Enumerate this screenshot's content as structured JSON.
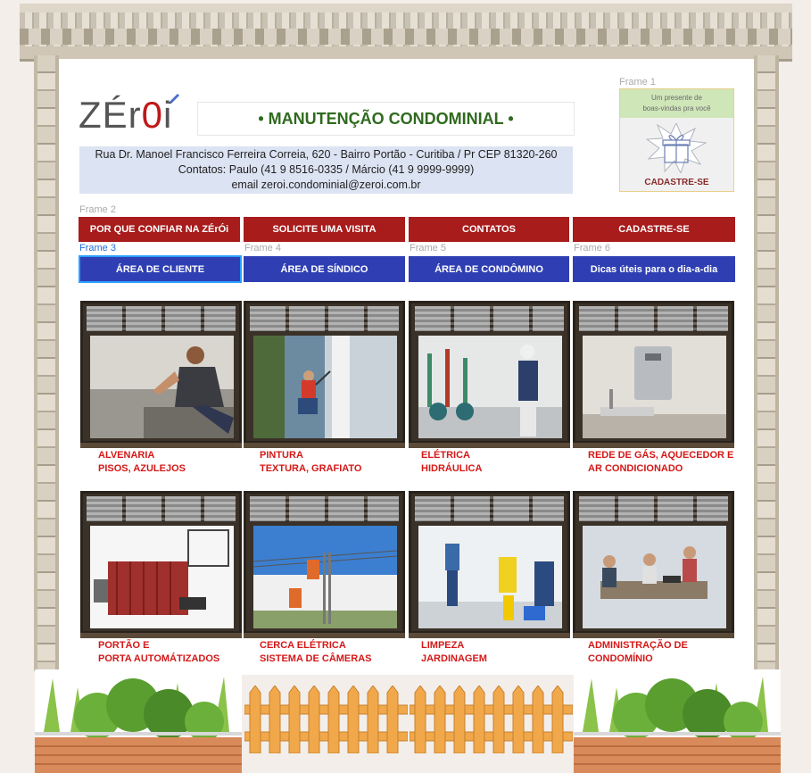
{
  "header": {
    "logo_text_a": "ZÉr",
    "logo_text_o": "0",
    "logo_text_b": "i",
    "title": "• MANUTENÇÃO CONDOMINIAL •",
    "address": "Rua Dr. Manoel Francisco Ferreira Correia, 620 - Bairro Portão - Curitiba / Pr CEP 81320-260",
    "contacts": "Contatos: Paulo (41 9 8516-0335 / Márcio (41 9 9999-9999)",
    "email": "email zeroi.condominial@zeroi.com.br"
  },
  "gift_panel": {
    "frame_label": "Frame 1",
    "line1": "Um presente de",
    "line2": "boas-vindas pra você",
    "cta": "CADASTRE-SE"
  },
  "frames": {
    "f2": "Frame 2",
    "f3": "Frame 3",
    "f4": "Frame 4",
    "f5": "Frame 5",
    "f6": "Frame 6"
  },
  "nav_red": [
    "POR QUE CONFIAR NA ZÉrÓi",
    "SOLICITE UMA VISITA",
    "CONTATOS",
    "CADASTRE-SE"
  ],
  "nav_blue": [
    "ÁREA DE CLIENTE",
    "ÁREA DE SÍNDICO",
    "ÁREA DE CONDÔMINO",
    "Dicas úteis para o dia-a-dia"
  ],
  "services": [
    {
      "l1": "ALVENARIA",
      "l2": "PISOS, AZULEJOS"
    },
    {
      "l1": "PINTURA",
      "l2": "TEXTURA, GRAFIATO"
    },
    {
      "l1": "ELÉTRICA",
      "l2": "HIDRÁULICA"
    },
    {
      "l1": "REDE DE GÁS, AQUECEDOR E",
      "l2": "AR CONDICIONADO"
    },
    {
      "l1": "PORTÃO E",
      "l2": "PORTA AUTOMÁTIZADOS"
    },
    {
      "l1": "CERCA ELÉTRICA",
      "l2": "SISTEMA DE CÂMERAS"
    },
    {
      "l1": "LIMPEZA",
      "l2": "JARDINAGEM"
    },
    {
      "l1": "ADMINISTRAÇÃO DE",
      "l2": "CONDOMÍNIO"
    }
  ],
  "colors": {
    "nav_red": "#a81c1c",
    "nav_blue": "#2f3fb3",
    "caption_red": "#d41818",
    "title_green": "#2f6a1e"
  }
}
